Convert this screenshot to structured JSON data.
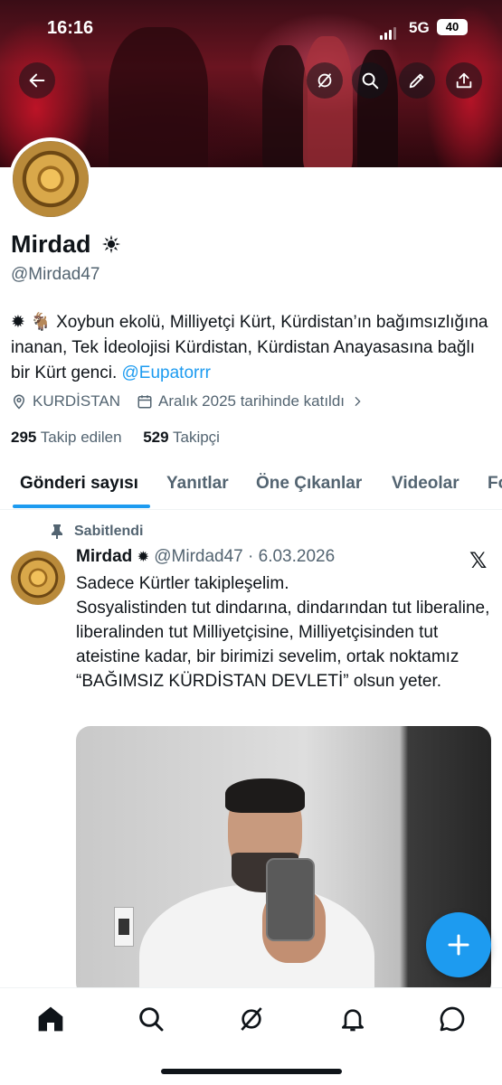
{
  "status_bar": {
    "time": "16:16",
    "network": "5G",
    "battery": "40"
  },
  "header": {
    "icons": [
      "back-icon",
      "grok-icon",
      "search-icon",
      "edit-icon",
      "share-icon"
    ]
  },
  "profile": {
    "name": "Mirdad",
    "handle": "@Mirdad47",
    "bio_text": "✹ 🐐 Xoybun ekolü, Milliyetçi Kürt, Kürdistan’ın bağımsızlığına inanan, Tek İdeolojisi Kürdistan, Kürdistan Anayasasına bağlı bir Kürt genci. ",
    "bio_mention": "@Eupatorrr",
    "location": "KURDİSTAN",
    "joined": "Aralık 2025 tarihinde katıldı",
    "following_count": "295",
    "following_label": "Takip edilen",
    "followers_count": "529",
    "followers_label": "Takipçi"
  },
  "tabs": [
    "Gönderi sayısı",
    "Yanıtlar",
    "Öne Çıkanlar",
    "Videolar",
    "Fo"
  ],
  "tweet": {
    "pinned_label": "Sabitlendi",
    "author": "Mirdad",
    "handle_date": "@Mirdad47 · 6.03.2026",
    "text": "Sadece Kürtler takipleşelim.\nSosyalistinden tut dindarına, dindarından tut liberaline, liberalinden tut Milliyetçisine, Milliyetçisinden tut ateistine kadar, bir birimizi sevelim, ortak noktamız “BAĞIMSIZ KÜRDİSTAN DEVLETİ” olsun yeter."
  },
  "fab": {
    "icon": "plus-icon"
  },
  "bottom_nav": [
    "home-icon",
    "search-icon",
    "grok-icon",
    "notifications-icon",
    "messages-icon"
  ],
  "colors": {
    "accent": "#1d9bf0",
    "text": "#0f1419",
    "muted": "#536471"
  }
}
